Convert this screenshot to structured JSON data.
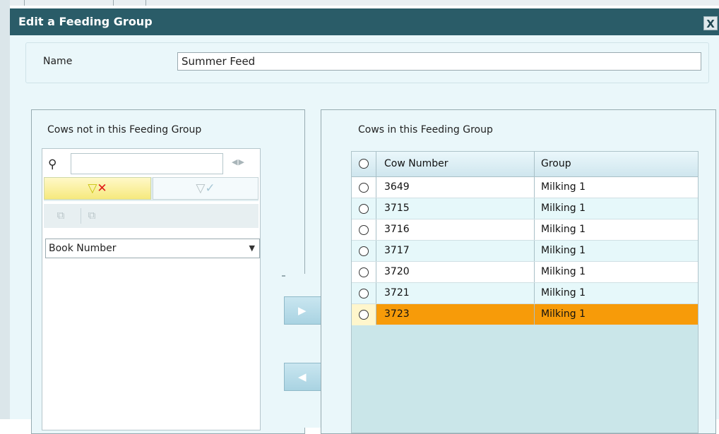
{
  "dialog": {
    "title": "Edit a Feeding Group",
    "close_label": "X"
  },
  "name_field": {
    "label": "Name",
    "value": "Summer Feed"
  },
  "left_panel": {
    "heading": "Cows not in this Feeding Group",
    "search_placeholder": "",
    "filter_tabs": [
      {
        "icon": "funnel-clear-icon",
        "symbol": "▽",
        "mark": "✕"
      },
      {
        "icon": "funnel-apply-icon",
        "symbol": "▽",
        "mark": "✓"
      }
    ],
    "tools": [
      {
        "icon": "add-copy-icon",
        "symbol": "⧉"
      },
      {
        "icon": "remove-copy-icon",
        "symbol": "⧉"
      }
    ],
    "dropdown_value": "Book Number"
  },
  "move_buttons": {
    "add_symbol": "▶",
    "remove_symbol": "◀"
  },
  "right_panel": {
    "heading": "Cows in this Feeding Group",
    "columns": [
      "Cow Number",
      "Group"
    ],
    "rows": [
      {
        "cow_number": "3649",
        "group": "Milking 1"
      },
      {
        "cow_number": "3715",
        "group": "Milking 1"
      },
      {
        "cow_number": "3716",
        "group": "Milking 1"
      },
      {
        "cow_number": "3717",
        "group": "Milking 1"
      },
      {
        "cow_number": "3720",
        "group": "Milking 1"
      },
      {
        "cow_number": "3721",
        "group": "Milking 1"
      },
      {
        "cow_number": "3723",
        "group": "Milking 1"
      }
    ],
    "selected_row_index": 6
  },
  "colors": {
    "titlebar": "#2a5c68",
    "selected_row": "#f79b09",
    "panel_bg": "#eaf7fa"
  }
}
